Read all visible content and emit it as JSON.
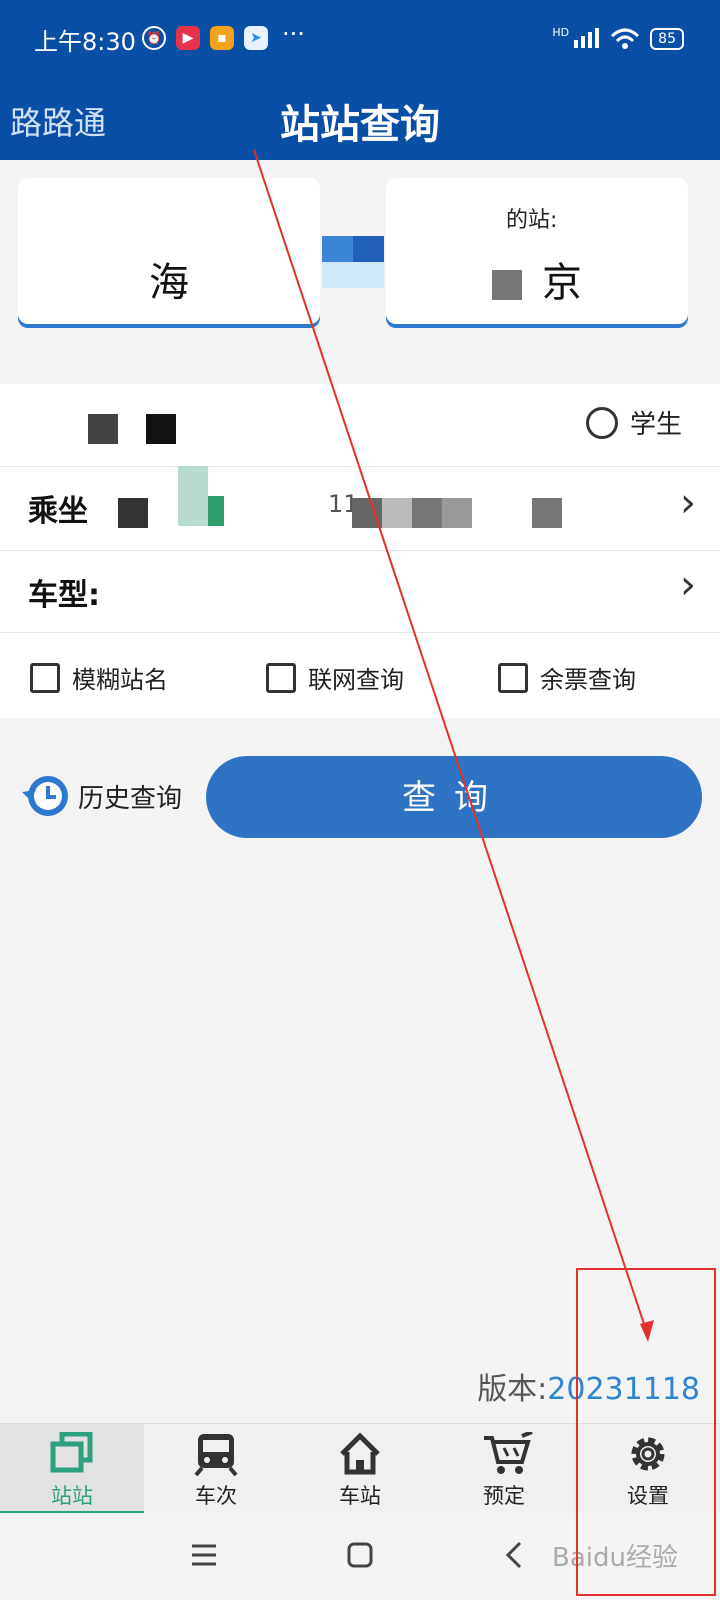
{
  "status_bar": {
    "time": "上午8:30",
    "more": "···",
    "network": "HD",
    "battery": "85"
  },
  "header": {
    "back_label": "路路通",
    "title": "站站查询"
  },
  "stations": {
    "from": {
      "label": "",
      "name": "海"
    },
    "to": {
      "label": "的站:",
      "name": "京"
    }
  },
  "form": {
    "student_label": "学生",
    "ride_label": "乘坐",
    "ride_value": "11",
    "type_label": "车型:",
    "checks": [
      "模糊站名",
      "联网查询",
      "余票查询"
    ]
  },
  "history_label": "历史查询",
  "query_label": "查询",
  "version": {
    "label": "版本:",
    "number": "20231118"
  },
  "tabs": [
    {
      "label": "站站",
      "icon": "layers-icon",
      "active": true
    },
    {
      "label": "车次",
      "icon": "train-icon",
      "active": false
    },
    {
      "label": "车站",
      "icon": "home-icon",
      "active": false
    },
    {
      "label": "预定",
      "icon": "cart-icon",
      "active": false
    },
    {
      "label": "设置",
      "icon": "gear-icon",
      "active": false
    }
  ],
  "watermark": "Baidu经验",
  "colors": {
    "primary": "#0a4fa6",
    "button": "#2f73c5",
    "accent_green": "#2da07e",
    "annotation": "#e2312c"
  }
}
